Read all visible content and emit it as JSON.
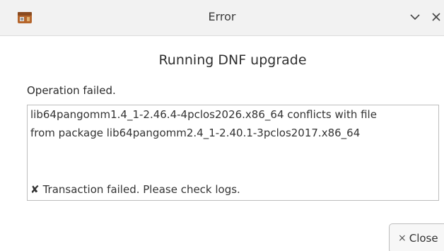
{
  "window": {
    "title": "Error",
    "app_icon": "package-icon",
    "controls": {
      "minimize_icon": "chevron-down-icon",
      "close_icon": "close-icon"
    }
  },
  "dialog": {
    "heading": "Running DNF upgrade",
    "status": "Operation failed.",
    "log_lines": [
      "lib64pangomm1.4_1-2.46.4-4pclos2026.x86_64 conflicts with file",
      "from package lib64pangomm2.4_1-2.40.1-3pclos2017.x86_64"
    ],
    "error_mark": "✘",
    "error_text": "Transaction failed. Please check logs.",
    "close_button": {
      "icon": "×",
      "label": "Close"
    }
  },
  "colors": {
    "titlebar_bg": "#f2f2f2",
    "border": "#bdbdbd",
    "text": "#2b2b2b"
  }
}
